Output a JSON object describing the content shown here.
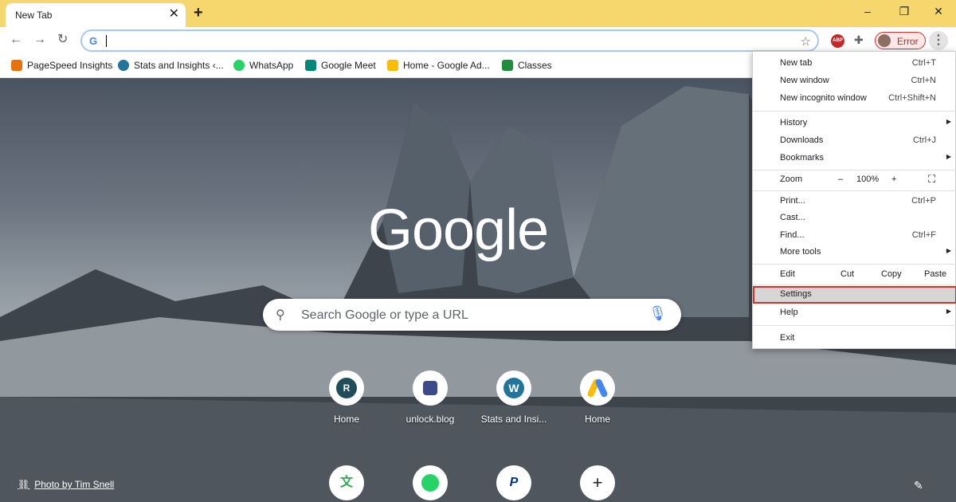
{
  "tab": {
    "title": "New Tab",
    "close": "✕",
    "new": "+"
  },
  "window": {
    "minimize": "–",
    "restore": "❐",
    "close": "✕"
  },
  "nav": {
    "back": "←",
    "forward": "→",
    "reload": "↻"
  },
  "omnibox": {
    "value": "",
    "g": "G",
    "star": "☆"
  },
  "extensions": {
    "abp": "ABP",
    "puzzle": "✚"
  },
  "profile": {
    "label": "Error"
  },
  "bookmarks": [
    {
      "label": "PageSpeed Insights",
      "color": "#e8710a"
    },
    {
      "label": "Stats and Insights ‹...",
      "color": "#21759b"
    },
    {
      "label": "WhatsApp",
      "color": "#25d366"
    },
    {
      "label": "Google Meet",
      "color": "#00897b"
    },
    {
      "label": "Home - Google Ad...",
      "color": "#fbbc04"
    },
    {
      "label": "Classes",
      "color": "#1e8e3e"
    }
  ],
  "ntp": {
    "logo": "Google",
    "search_placeholder": "Search Google or type a URL",
    "shortcuts": [
      {
        "letter": "R",
        "label": "Home"
      },
      {
        "letter": "",
        "label": "unlock.blog"
      },
      {
        "letter": "W",
        "label": "Stats and Insi..."
      },
      {
        "letter": "",
        "label": "Home"
      }
    ],
    "shortcuts_row2": [
      {
        "letter": "",
        "label": ""
      },
      {
        "letter": "",
        "label": ""
      },
      {
        "letter": "P",
        "label": ""
      },
      {
        "letter": "+",
        "label": ""
      }
    ],
    "credit": "Photo by Tim Snell"
  },
  "menu": {
    "new_tab": {
      "label": "New tab",
      "key": "Ctrl+T"
    },
    "new_window": {
      "label": "New window",
      "key": "Ctrl+N"
    },
    "incognito": {
      "label": "New incognito window",
      "key": "Ctrl+Shift+N"
    },
    "history": {
      "label": "History"
    },
    "downloads": {
      "label": "Downloads",
      "key": "Ctrl+J"
    },
    "bookmarks": {
      "label": "Bookmarks"
    },
    "zoom": {
      "label": "Zoom",
      "minus": "–",
      "value": "100%",
      "plus": "+"
    },
    "print": {
      "label": "Print...",
      "key": "Ctrl+P"
    },
    "cast": {
      "label": "Cast..."
    },
    "find": {
      "label": "Find...",
      "key": "Ctrl+F"
    },
    "more_tools": {
      "label": "More tools"
    },
    "edit": {
      "label": "Edit",
      "cut": "Cut",
      "copy": "Copy",
      "paste": "Paste"
    },
    "settings": {
      "label": "Settings"
    },
    "help": {
      "label": "Help"
    },
    "exit": {
      "label": "Exit"
    }
  }
}
